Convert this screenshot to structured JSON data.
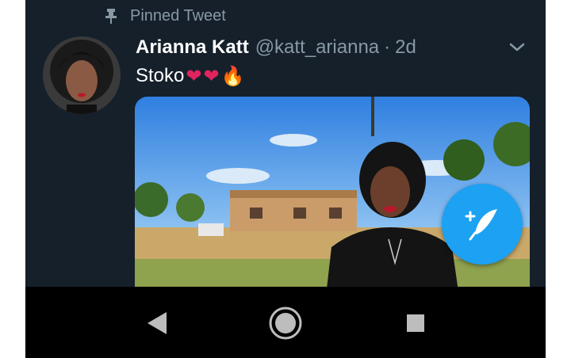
{
  "pinned": {
    "icon": "pin-icon",
    "label": "Pinned Tweet"
  },
  "tweet": {
    "author_name": "Arianna Katt",
    "author_handle": "@katt_arianna",
    "separator": "·",
    "time": "2d",
    "text": "Stoko",
    "emojis": [
      "❤",
      "❤",
      "🔥"
    ],
    "menu_icon": "chevron-down-icon"
  },
  "compose_button": {
    "icon": "compose-feather-icon"
  },
  "navbar": {
    "back_icon": "back-triangle-icon",
    "home_icon": "home-circle-icon",
    "recents_icon": "recents-square-icon"
  },
  "colors": {
    "background": "#15202b",
    "text_primary": "#ffffff",
    "text_secondary": "#8899a6",
    "accent": "#1da1f2",
    "navbar": "#000000"
  }
}
